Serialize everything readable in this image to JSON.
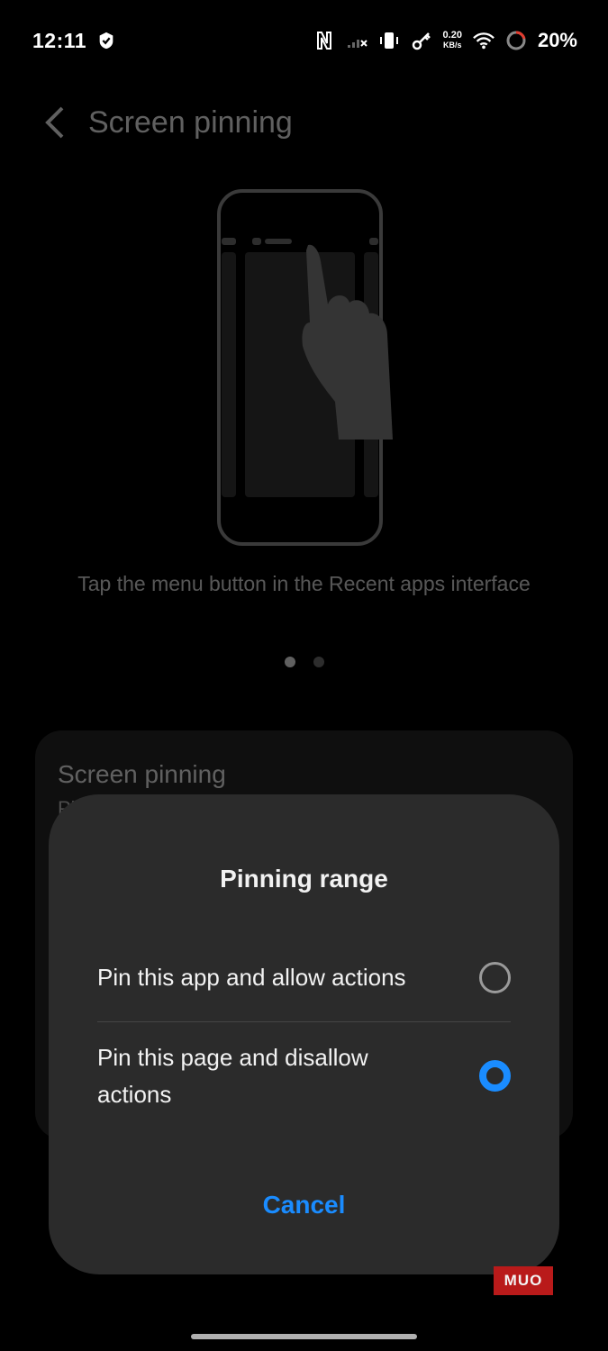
{
  "status_bar": {
    "time": "12:11",
    "speed_value": "0.20",
    "speed_unit": "KB/s",
    "battery": "20%"
  },
  "header": {
    "title": "Screen pinning",
    "back_icon": "chevron-left-icon"
  },
  "illustration": {
    "caption": "Tap the menu button in the Recent apps interface",
    "page_dots": 2,
    "active_dot": 1
  },
  "settings_card": {
    "title": "Screen pinning",
    "subtitle_partial": "Pi"
  },
  "dialog": {
    "title": "Pinning range",
    "options": [
      {
        "label": "Pin this app and allow actions",
        "selected": false
      },
      {
        "label": "Pin this page and disallow actions",
        "selected": true
      }
    ],
    "cancel_label": "Cancel"
  },
  "watermark": "MUO",
  "colors": {
    "accent": "#1a8cff",
    "dialog_bg": "#2b2b2b",
    "background": "#000000"
  }
}
